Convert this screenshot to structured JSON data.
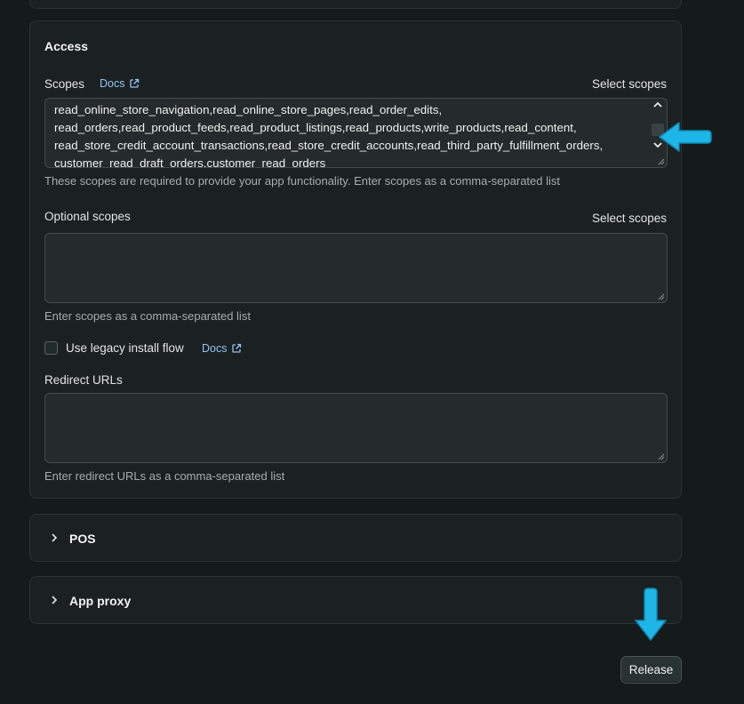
{
  "access": {
    "title": "Access",
    "scopes_label": "Scopes",
    "docs_label": "Docs",
    "select_scopes_label": "Select scopes",
    "scopes_value": "read_online_store_navigation,read_online_store_pages,read_order_edits,\nread_orders,read_product_feeds,read_product_listings,read_products,write_products,read_content,\nread_store_credit_account_transactions,read_store_credit_accounts,read_third_party_fulfillment_orders,\ncustomer_read_draft_orders,customer_read_orders",
    "scopes_help": "These scopes are required to provide your app functionality. Enter scopes as a comma-separated list",
    "optional_scopes_label": "Optional scopes",
    "optional_select_scopes_label": "Select scopes",
    "optional_scopes_value": "",
    "optional_scopes_help": "Enter scopes as a comma-separated list",
    "legacy_install_label": "Use legacy install flow",
    "legacy_docs_label": "Docs",
    "legacy_install_checked": false,
    "redirect_urls_label": "Redirect URLs",
    "redirect_urls_value": "",
    "redirect_urls_help": "Enter redirect URLs as a comma-separated list"
  },
  "sections": {
    "pos_label": "POS",
    "app_proxy_label": "App proxy"
  },
  "actions": {
    "release_label": "Release"
  },
  "colors": {
    "background": "#151a1a",
    "card": "#1b2121",
    "link": "#8ec4f5",
    "callout_arrow": "#1eb6e8"
  },
  "icons": {
    "docs": "external-link-icon",
    "chevron": "chevron-right-icon",
    "callout": "arrow-icon"
  }
}
